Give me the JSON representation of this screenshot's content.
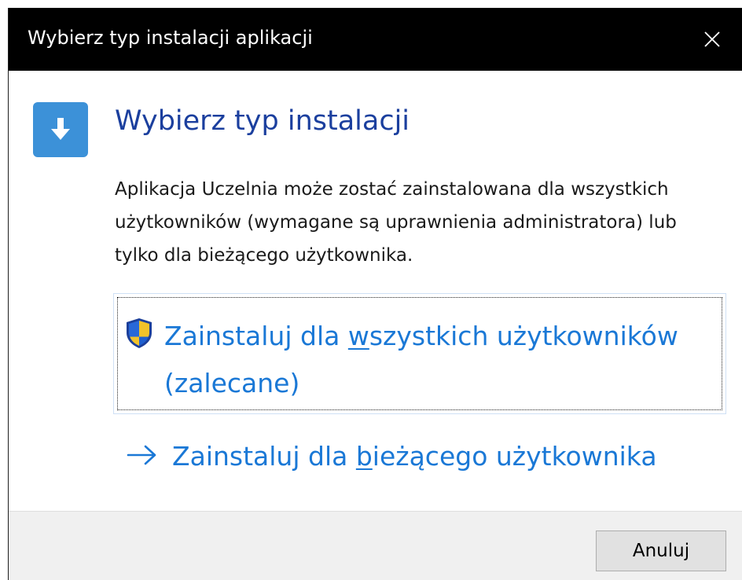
{
  "window": {
    "title": "Wybierz typ instalacji aplikacji",
    "close_icon": "close-icon"
  },
  "header": {
    "icon": "download-arrow-icon",
    "icon_color": "#3c91d8",
    "heading": "Wybierz typ instalacji",
    "heading_color": "#1b3f9e"
  },
  "description": "Aplikacja Uczelnia może zostać zainstalowana dla wszystkich użytkowników (wymagane są uprawnienia administratora) lub tylko dla bieżącego użytkownika.",
  "options": {
    "all_users": {
      "icon": "uac-shield-icon",
      "label_before": "Zainstaluj dla ",
      "label_accel": "w",
      "label_after": "szystkich użytkowników (zalecane)",
      "color": "#1a78d6"
    },
    "current_user": {
      "icon": "arrow-right-icon",
      "label_before": "Zainstaluj dla ",
      "label_accel": "b",
      "label_after": "ieżącego użytkownika",
      "color": "#1a78d6"
    }
  },
  "footer": {
    "cancel_label": "Anuluj"
  }
}
